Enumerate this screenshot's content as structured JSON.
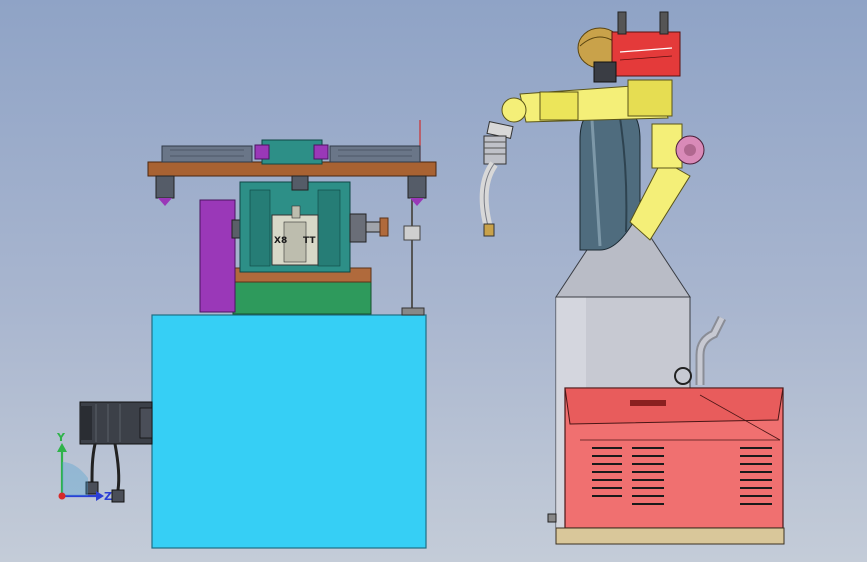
{
  "viewport": {
    "background_top": "#8fa3c6",
    "background_bottom": "#c4ccd8"
  },
  "fixture": {
    "stamp_label": "X8",
    "stamp_label_2": "TT",
    "colors": {
      "base": "#36cff5",
      "plate": "#2e9a5c",
      "plate_top": "#b06a3c",
      "housing": "#2d8f87",
      "arm": "#9a38b8",
      "rim": "#a86232",
      "motor": "#3c4048"
    }
  },
  "robot": {
    "colors": {
      "arm": "#f4ef78",
      "head": "#e43a3a",
      "body": "#4f6c7e",
      "torch": "#d8d8d8"
    }
  },
  "welder": {
    "colors": {
      "cabinet": "#f07070",
      "hopper": "#c7c9d2",
      "vent": "#1a1a1a"
    }
  },
  "triad": {
    "y_label": "Y",
    "z_label": "Z",
    "y_color": "#2fb34a",
    "z_color": "#2c3fd6",
    "origin_color": "#d62a2a"
  }
}
